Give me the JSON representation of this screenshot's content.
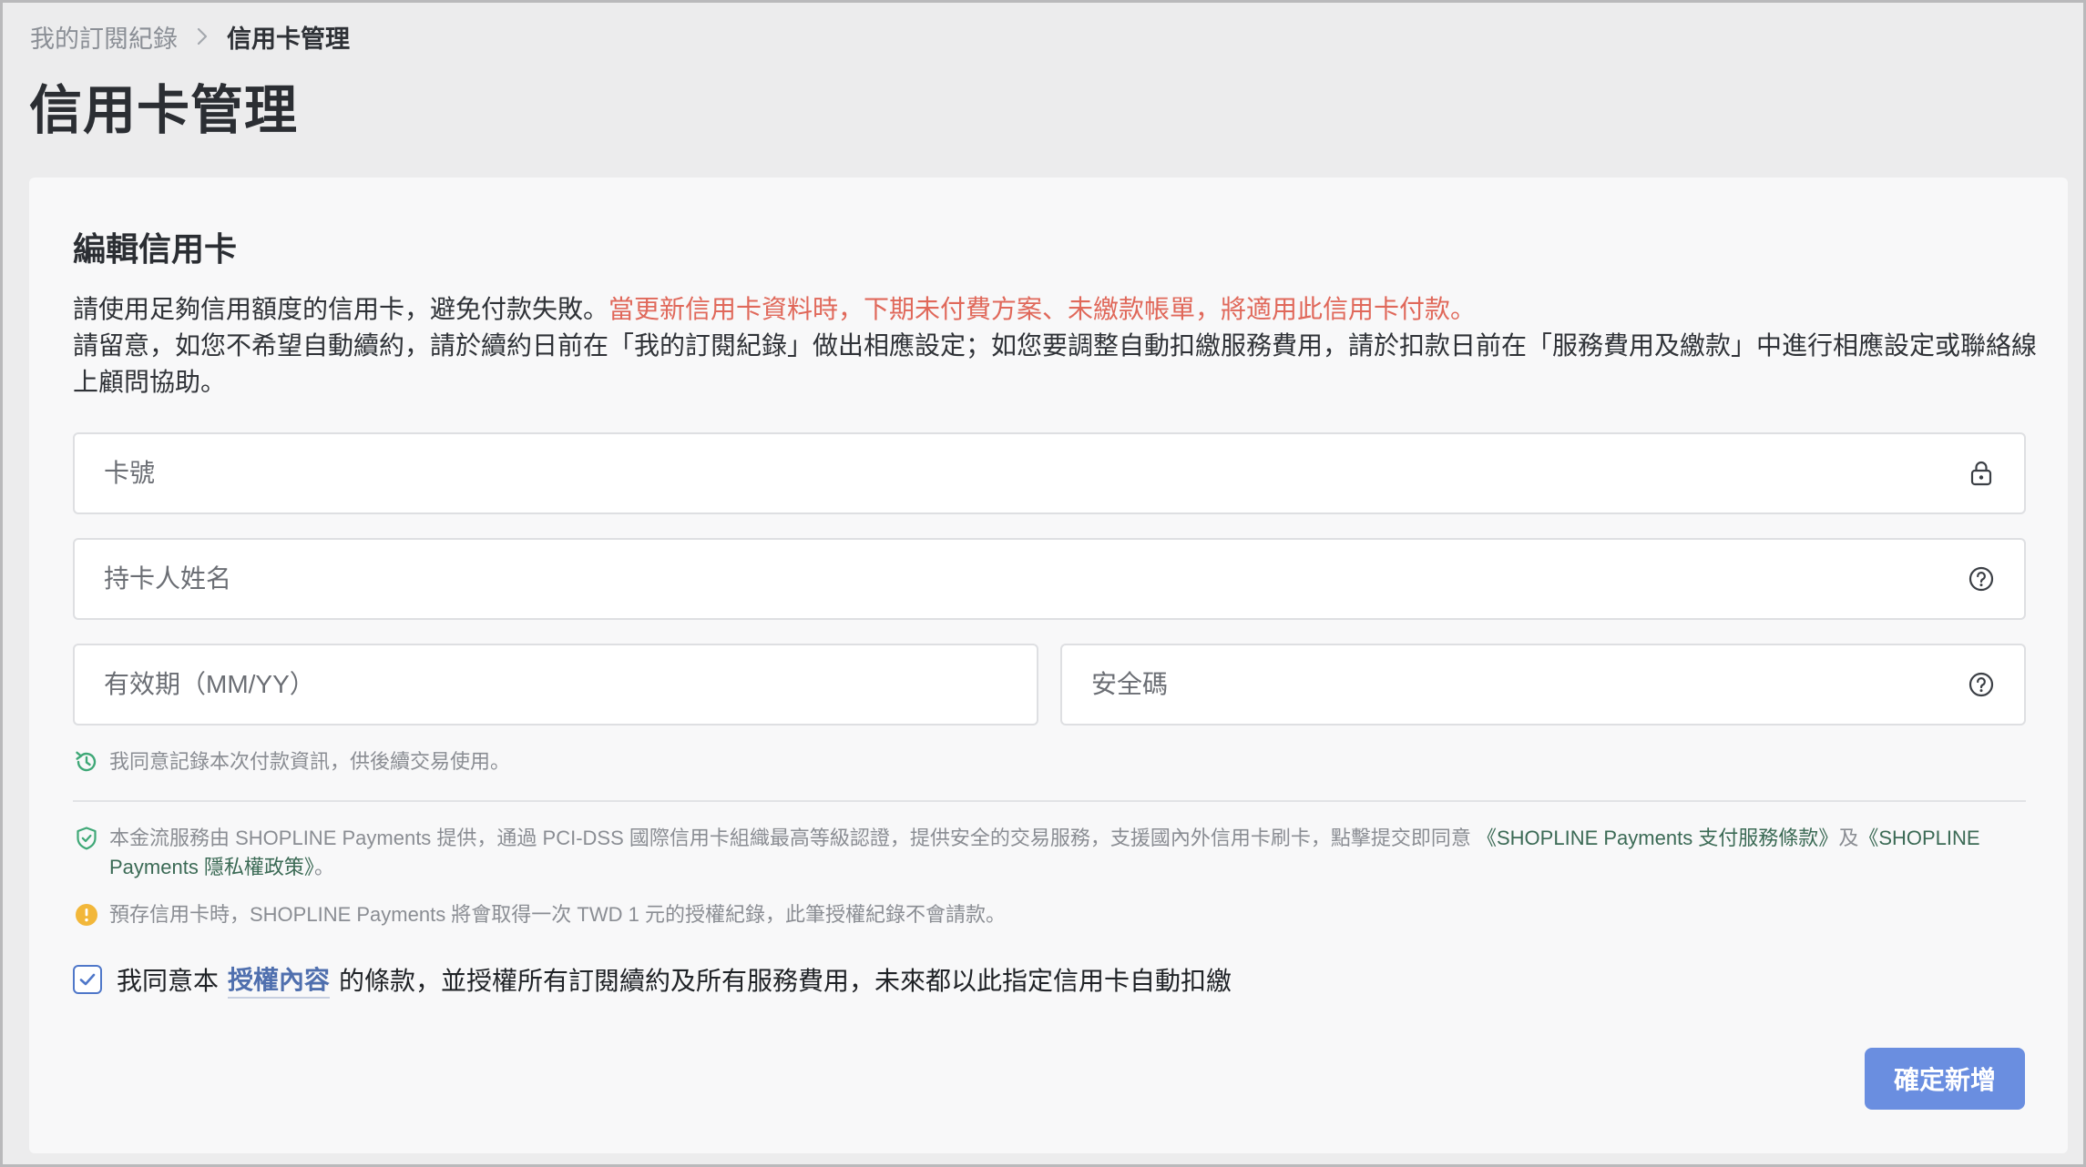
{
  "breadcrumb": {
    "parent": "我的訂閱紀錄",
    "current": "信用卡管理"
  },
  "page_title": "信用卡管理",
  "card": {
    "title": "編輯信用卡",
    "desc_line1_normal": "請使用足夠信用額度的信用卡，避免付款失敗。",
    "desc_line1_warning": "當更新信用卡資料時，下期未付費方案、未繳款帳單，將適用此信用卡付款。",
    "desc_line2": "請留意，如您不希望自動續約，請於續約日前在「我的訂閱紀錄」做出相應設定；如您要調整自動扣繳服務費用，請於扣款日前在「服務費用及繳款」中進行相應設定或聯絡線上顧問協助。",
    "warning_color": "#e0685a"
  },
  "form": {
    "card_number_placeholder": "卡號",
    "card_number_value": "",
    "holder_name_placeholder": "持卡人姓名",
    "holder_name_value": "",
    "expiry_placeholder": "有效期（MM/YY）",
    "expiry_value": "",
    "cvc_placeholder": "安全碼",
    "cvc_value": ""
  },
  "notes": {
    "save_info": "我同意記錄本次付款資訊，供後續交易使用。",
    "security_prefix": "本金流服務由 SHOPLINE Payments 提供，通過 PCI-DSS 國際信用卡組織最高等級認證，提供安全的交易服務，支援國內外信用卡刷卡，點擊提交即同意 ",
    "terms_link": "《SHOPLINE Payments 支付服務條款》",
    "and": "及",
    "privacy_link": "《SHOPLINE Payments 隱私權政策》",
    "security_suffix": "。",
    "preauth": "預存信用卡時，SHOPLINE Payments 將會取得一次 TWD 1 元的授權紀錄，此筆授權紀錄不會請款。"
  },
  "agreement": {
    "checked": true,
    "prefix": "我同意本",
    "link": "授權內容",
    "suffix": "的條款，並授權所有訂閱續約及所有服務費用，未來都以此指定信用卡自動扣繳"
  },
  "submit_label": "確定新增",
  "icons": {
    "card_number": "lock-icon",
    "holder_name": "help-circle-icon",
    "cvc": "help-circle-icon",
    "save_info": "history-refresh-icon",
    "security": "shield-check-icon",
    "preauth": "info-icon",
    "checkbox": "checkmark-icon",
    "breadcrumb_separator": "chevron-right-icon"
  },
  "colors": {
    "accent": "#6a8ee0",
    "link_green": "#3b6a55",
    "icon_green": "#3fa877",
    "info_yellow": "#f2b73a"
  }
}
